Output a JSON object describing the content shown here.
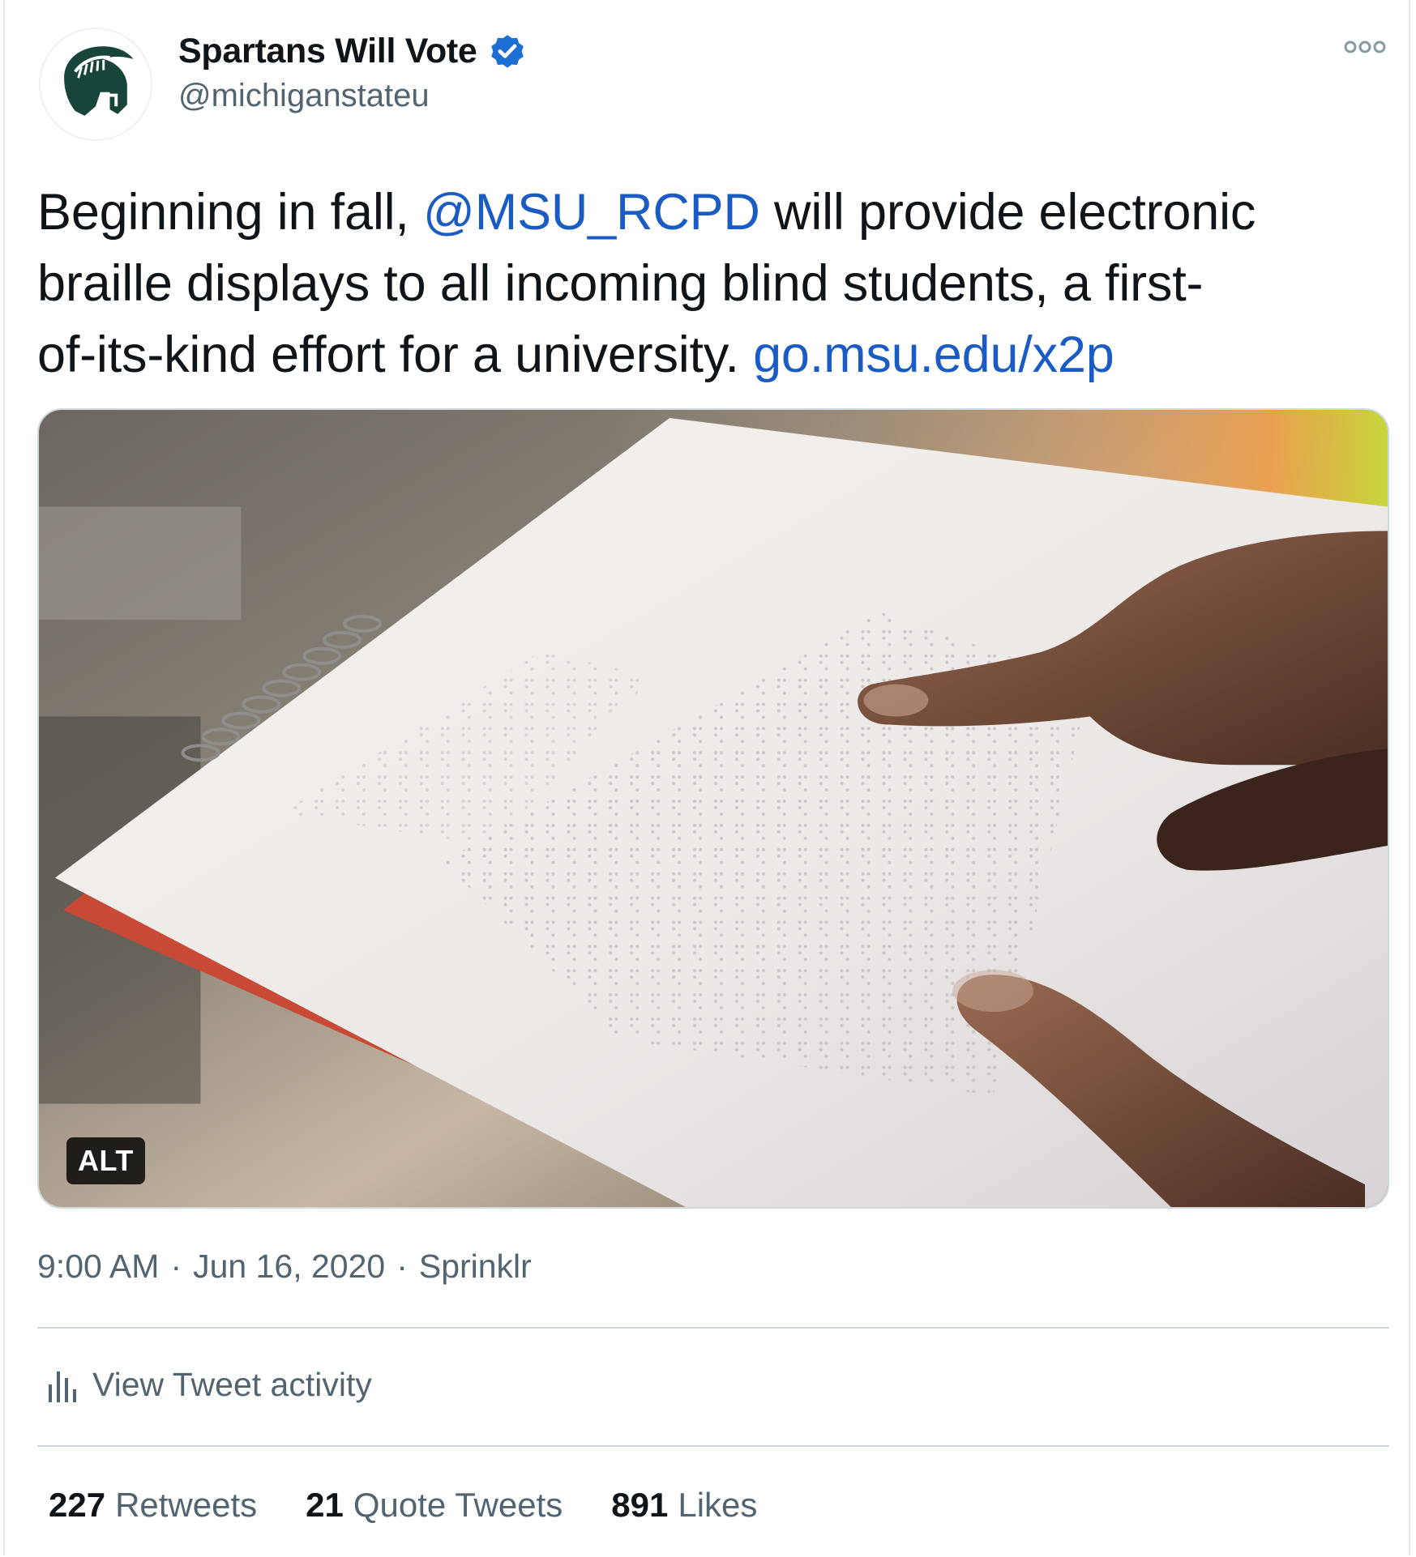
{
  "account": {
    "display_name": "Spartans Will Vote",
    "handle": "@michiganstateu",
    "verified": true,
    "avatar_icon": "spartan-helmet-icon",
    "brand_color": "#18453b"
  },
  "tweet": {
    "line1_prefix": "Beginning in fall, ",
    "mention": "@MSU_RCPD",
    "line1_suffix": " will provide electronic",
    "line2": "braille displays to all incoming blind students, a first-",
    "line3_prefix": "of-its-kind effort for a university. ",
    "link": "go.msu.edu/x2p",
    "link_color": "#1b5cc4"
  },
  "media": {
    "alt_badge": "ALT",
    "icon": "braille-notebook-photo"
  },
  "meta": {
    "time": "9:00 AM",
    "separator": "·",
    "date": "Jun 16, 2020",
    "source": "Sprinklr"
  },
  "activity": {
    "label": "View Tweet activity",
    "icon": "bar-chart-icon"
  },
  "stats": {
    "retweets_count": "227",
    "retweets_label": "Retweets",
    "quotes_count": "21",
    "quotes_label": "Quote Tweets",
    "likes_count": "891",
    "likes_label": "Likes"
  },
  "colors": {
    "text_primary": "#0f1419",
    "text_secondary": "#536471",
    "verified_blue": "#1d6fd6",
    "divider": "#cfd9de"
  }
}
